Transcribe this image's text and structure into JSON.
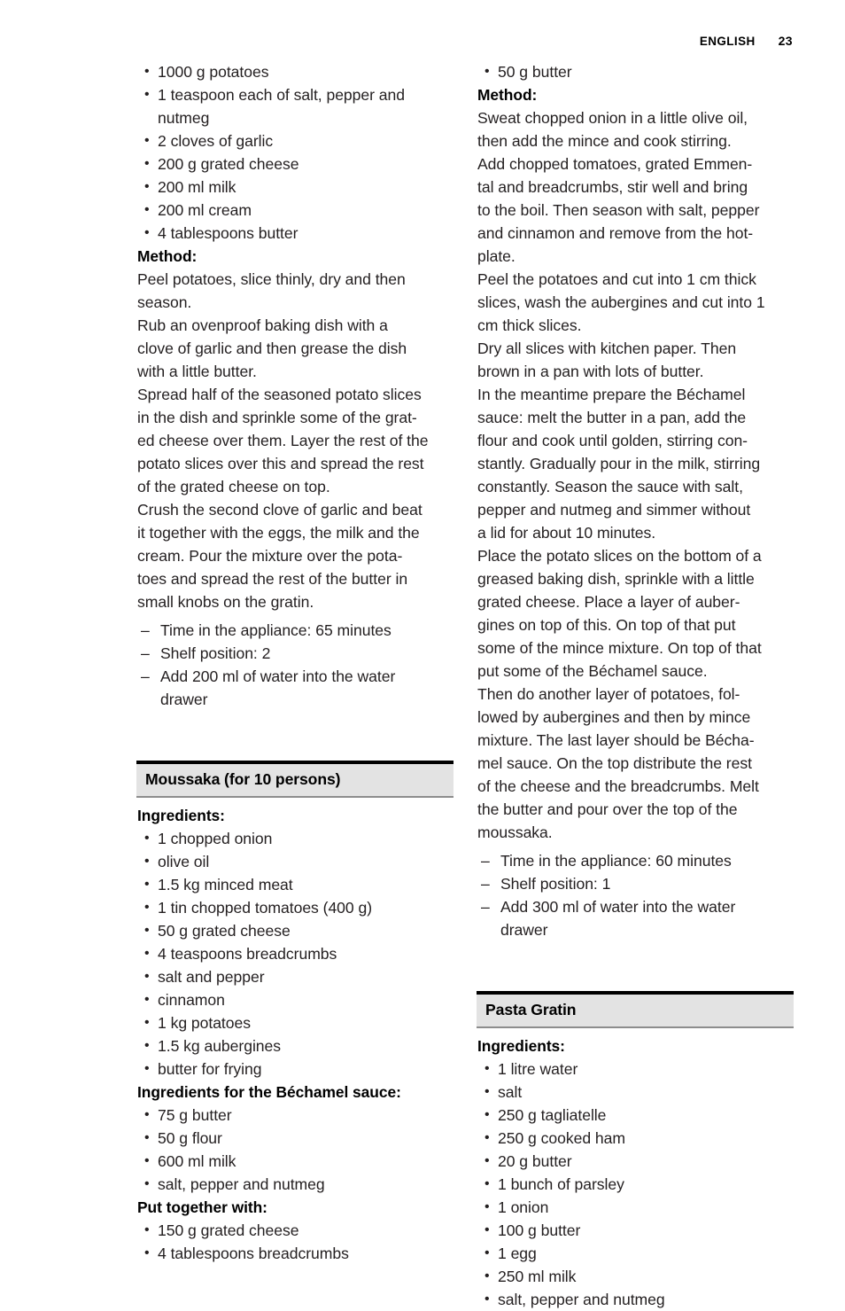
{
  "header": {
    "language": "ENGLISH",
    "page_number": "23"
  },
  "left_column": {
    "potato_gratin_ingredients": [
      "1000 g potatoes",
      "1 teaspoon each of salt, pepper and\nnutmeg",
      "2 cloves of garlic",
      "200 g grated cheese",
      "200 ml milk",
      "200 ml cream",
      "4 tablespoons butter"
    ],
    "method_label": "Method:",
    "method_text": "Peel potatoes, slice thinly, dry and then\nseason.\nRub an ovenproof baking dish with a\nclove of garlic and then grease the dish\nwith a little butter.\nSpread half of the seasoned potato slices\nin the dish and sprinkle some of the grat-\ned cheese over them. Layer the rest of the\npotato slices over this and spread the rest\nof the grated cheese on top.\nCrush the second clove of garlic and beat\nit together with the eggs, the milk and the\ncream. Pour the mixture over the pota-\ntoes and spread the rest of the butter in\nsmall knobs on the gratin.",
    "settings": [
      "Time in the appliance: 65 minutes",
      "Shelf position: 2",
      "Add 200 ml of water into the water\ndrawer"
    ],
    "moussaka": {
      "title": "Moussaka (for 10 persons)",
      "ingredients_label": "Ingredients:",
      "ingredients": [
        "1 chopped onion",
        "olive oil",
        "1.5 kg minced meat",
        "1 tin chopped tomatoes (400 g)",
        "50 g grated cheese",
        "4 teaspoons breadcrumbs",
        "salt and pepper",
        "cinnamon",
        "1 kg potatoes",
        "1.5 kg aubergines",
        "butter for frying"
      ],
      "bechamel_label": "Ingredients for the Béchamel sauce:",
      "bechamel_ingredients": [
        "75 g butter",
        "50 g flour",
        "600 ml milk",
        "salt, pepper and nutmeg"
      ],
      "put_together_label": "Put together with:",
      "put_together_ingredients": [
        "150 g grated cheese",
        "4 tablespoons breadcrumbs"
      ]
    }
  },
  "right_column": {
    "continued_ingredients": [
      "50 g butter"
    ],
    "method_label": "Method:",
    "method_text": "Sweat chopped onion in a little olive oil,\nthen add the mince and cook stirring.\nAdd chopped tomatoes, grated Emmen-\ntal and breadcrumbs, stir well and bring\nto the boil. Then season with salt, pepper\nand cinnamon and remove from the hot-\nplate.\nPeel the potatoes and cut into 1 cm thick\nslices, wash the aubergines and cut into 1\ncm thick slices.\nDry all slices with kitchen paper. Then\nbrown in a pan with lots of butter.\nIn the meantime prepare the Béchamel\nsauce: melt the butter in a pan, add the\nflour and cook until golden, stirring con-\nstantly. Gradually pour in the milk, stirring\nconstantly. Season the sauce with salt,\npepper and nutmeg and simmer without\na lid for about 10 minutes.\nPlace the potato slices on the bottom of a\ngreased baking dish, sprinkle with a little\ngrated cheese. Place a layer of auber-\ngines on top of this. On top of that put\nsome of the mince mixture. On top of that\nput some of the Béchamel sauce.\nThen do another layer of potatoes, fol-\nlowed by aubergines and then by mince\nmixture. The last layer should be Bécha-\nmel sauce. On the top distribute the rest\nof the cheese and the breadcrumbs. Melt\nthe butter and pour over the top of the\nmoussaka.",
    "settings": [
      "Time in the appliance: 60 minutes",
      "Shelf position: 1",
      "Add 300 ml of water into the water\ndrawer"
    ],
    "pasta_gratin": {
      "title": "Pasta Gratin",
      "ingredients_label": "Ingredients:",
      "ingredients": [
        "1 litre water",
        "salt",
        "250 g tagliatelle",
        "250 g cooked ham",
        "20 g butter",
        "1 bunch of parsley",
        "1 onion",
        "100 g butter",
        "1 egg",
        "250 ml milk",
        "salt, pepper and nutmeg"
      ]
    }
  },
  "colors": {
    "band_fill": "#e3e3e3",
    "band_top_rule": "#000000",
    "band_bottom_rule": "#8d8d8d",
    "text": "#231f20"
  }
}
